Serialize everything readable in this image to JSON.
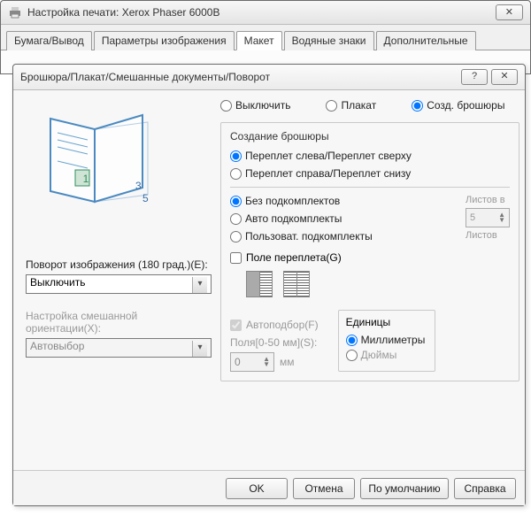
{
  "parent": {
    "title": "Настройка печати: Xerox Phaser 6000B",
    "tabs": [
      "Бумага/Вывод",
      "Параметры изображения",
      "Макет",
      "Водяные знаки",
      "Дополнительные"
    ],
    "active_tab": 2
  },
  "child": {
    "title": "Брошюра/Плакат/Смешанные документы/Поворот",
    "help_symbol": "?",
    "close_symbol": "✕"
  },
  "mode": {
    "off": "Выключить",
    "poster": "Плакат",
    "booklet": "Созд. брошюры",
    "selected": "booklet"
  },
  "booklet": {
    "group_title": "Создание брошюры",
    "bind_left": "Переплет слева/Переплет сверху",
    "bind_right": "Переплет справа/Переплет снизу",
    "bind_selected": "left",
    "subset_none": "Без подкомплектов",
    "subset_auto": "Авто подкомплекты",
    "subset_user": "Пользоват. подкомплекты",
    "subset_selected": "none",
    "sheets_in": "Листов в",
    "sheets_value": "5",
    "sheets_unit": "Листов",
    "gutter_check": "Поле переплета(G)",
    "autofit": "Автоподбор(F)",
    "margin_label": "Поля[0-50 мм](S):",
    "margin_value": "0",
    "margin_unit": "мм"
  },
  "rotation": {
    "label": "Поворот изображения (180 град.)(E):",
    "value": "Выключить",
    "mixed_label": "Настройка смешанной ориентации(X):",
    "mixed_value": "Автовыбор"
  },
  "units": {
    "title": "Единицы",
    "mm": "Миллиметры",
    "inch": "Дюймы",
    "selected": "mm"
  },
  "buttons": {
    "ok": "OK",
    "cancel": "Отмена",
    "defaults": "По умолчанию",
    "help": "Справка"
  },
  "preview_page_numbers": [
    "1",
    "3",
    "5"
  ]
}
